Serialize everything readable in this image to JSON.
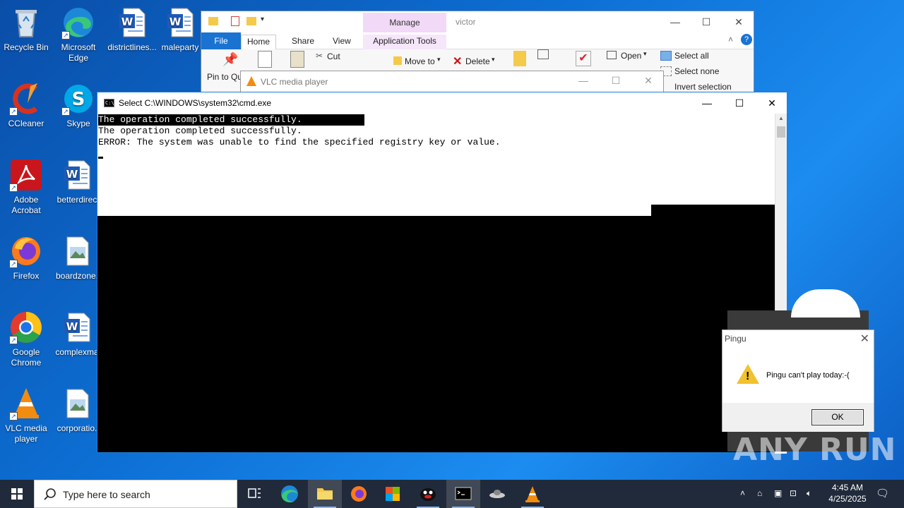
{
  "desktop": {
    "icons": [
      {
        "label": "Recycle Bin"
      },
      {
        "label": "Microsoft Edge"
      },
      {
        "label": "districtlines..."
      },
      {
        "label": "maleparty"
      },
      {
        "label": "CCleaner"
      },
      {
        "label": "Skype"
      },
      {
        "label": "Adobe Acrobat"
      },
      {
        "label": "betterdirec"
      },
      {
        "label": "Firefox"
      },
      {
        "label": "boardzone."
      },
      {
        "label": "Google Chrome"
      },
      {
        "label": "complexma"
      },
      {
        "label": "VLC media player"
      },
      {
        "label": "corporatio."
      }
    ]
  },
  "explorer": {
    "title": "victor",
    "manage_tab": "Manage",
    "tabs": {
      "file": "File",
      "home": "Home",
      "share": "Share",
      "view": "View",
      "app_tools": "Application Tools"
    },
    "ribbon": {
      "pin": "Pin to Qu",
      "cut": "Cut",
      "move_to": "Move to",
      "delete": "Delete",
      "open": "Open",
      "select_all": "Select all",
      "select_none": "Select none",
      "invert_selection": "Invert selection"
    }
  },
  "vlc": {
    "title": "VLC media player"
  },
  "cmd": {
    "title": "Select C:\\WINDOWS\\system32\\cmd.exe",
    "lines": [
      "The operation completed successfully.",
      "The operation completed successfully.",
      "ERROR: The system was unable to find the specified registry key or value."
    ]
  },
  "pingu": {
    "title": "Pingu",
    "message": "Pingu can't play today:-(",
    "ok_label": "OK"
  },
  "watermark": "ANY RUN",
  "taskbar": {
    "search_placeholder": "Type here to search",
    "time": "4:45 AM",
    "date": "4/25/2025"
  },
  "colors": {
    "accent": "#1a73d1",
    "manage_tab": "#f1d9f7",
    "warning": "#f2c12e",
    "vlc_orange": "#f28c0f"
  }
}
